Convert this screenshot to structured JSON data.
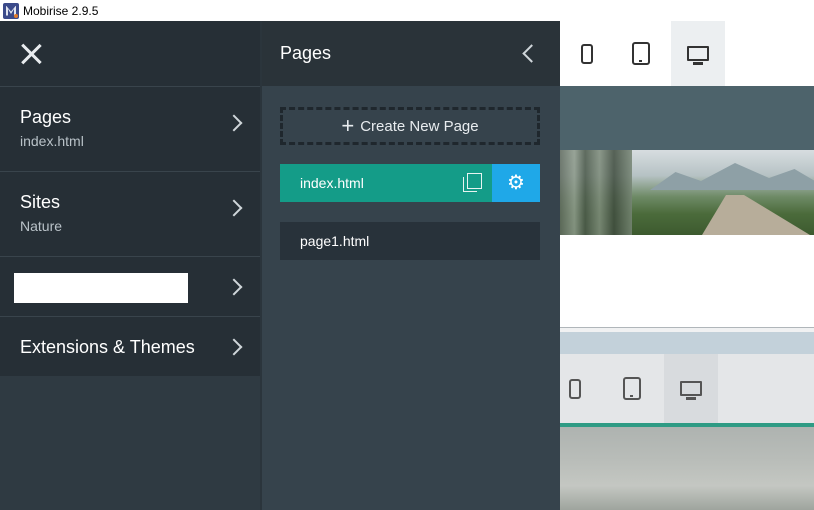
{
  "window": {
    "title": "Mobirise 2.9.5"
  },
  "left_menu": {
    "items": [
      {
        "title": "Pages",
        "subtitle": "index.html"
      },
      {
        "title": "Sites",
        "subtitle": "Nature"
      },
      {
        "title": "",
        "subtitle": ""
      },
      {
        "title": "Extensions & Themes",
        "subtitle": ""
      }
    ]
  },
  "pages_panel": {
    "title": "Pages",
    "create_label": "Create New Page",
    "pages": [
      {
        "name": "index.html",
        "active": true
      },
      {
        "name": "page1.html",
        "active": false
      }
    ]
  },
  "preview": {
    "devices": [
      "mobile",
      "tablet",
      "desktop"
    ],
    "active_device": "desktop"
  },
  "colors": {
    "active_page": "#149c88",
    "settings_button": "#1fa8e8",
    "sidebar": "#262f36"
  }
}
